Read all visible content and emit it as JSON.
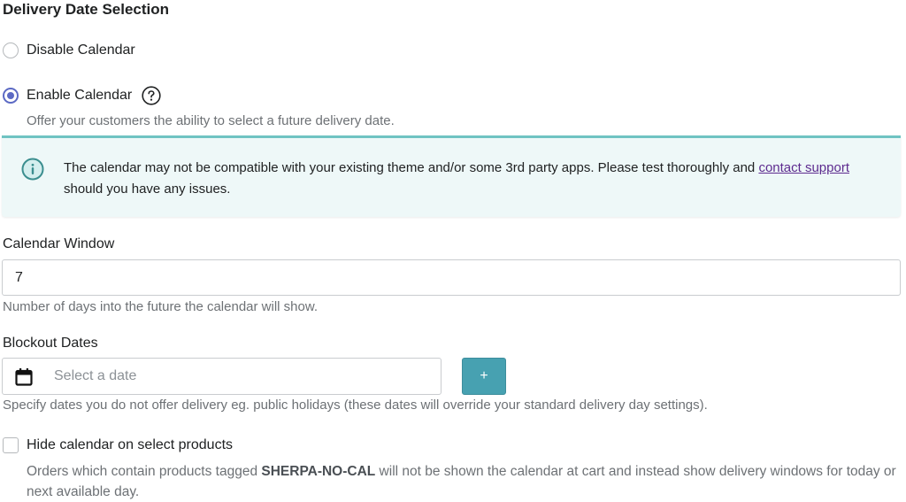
{
  "section": {
    "title": "Delivery Date Selection"
  },
  "calendar_mode": {
    "options": [
      {
        "label": "Disable Calendar",
        "selected": false
      },
      {
        "label": "Enable Calendar",
        "selected": true
      }
    ],
    "enable_help": "Offer your customers the ability to select a future delivery date."
  },
  "banner": {
    "text_before": "The calendar may not be compatible with your existing theme and/or some 3rd party apps. Please test thoroughly and ",
    "link_text": "contact support",
    "text_after": " should you have any issues.",
    "icon": "info-icon",
    "accent_color": "#6fc3c2",
    "background_color": "#eef8f8"
  },
  "calendar_window": {
    "label": "Calendar Window",
    "value": "7",
    "help": "Number of days into the future the calendar will show."
  },
  "blockout_dates": {
    "label": "Blockout Dates",
    "placeholder": "Select a date",
    "add_label": "+",
    "help": "Specify dates you do not offer delivery eg. public holidays (these dates will override your standard delivery day settings).",
    "icon": "calendar-icon"
  },
  "hide_calendar": {
    "label": "Hide calendar on select products",
    "checked": false,
    "help_before": "Orders which contain products tagged ",
    "tag": "SHERPA-NO-CAL",
    "help_after": " will not be shown the calendar at cart and instead show delivery windows for today or next available day."
  },
  "colors": {
    "radio_accent": "#5c6ac4",
    "button": "#47a1b1",
    "link": "#5d2b8f"
  }
}
